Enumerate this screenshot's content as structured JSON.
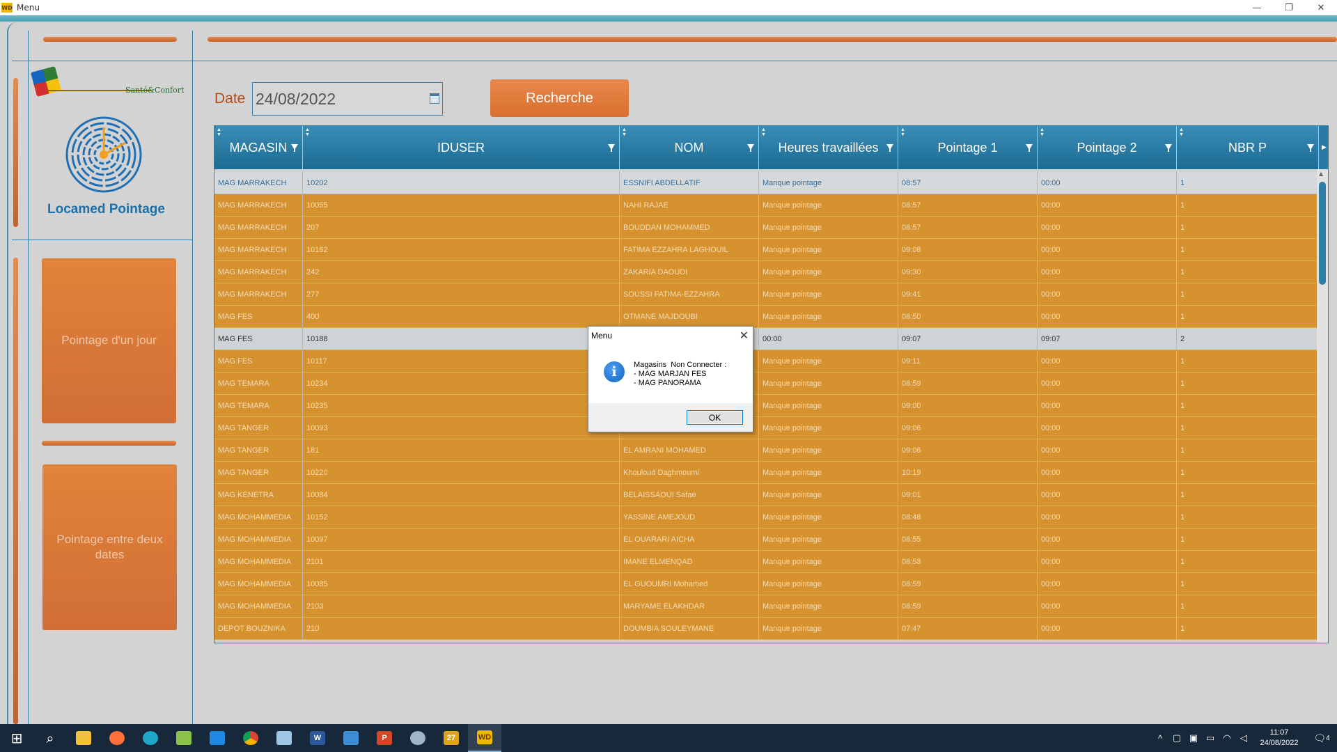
{
  "window": {
    "title": "Menu",
    "icon": "WD",
    "minimize": "—",
    "restore": "❐",
    "close": "✕"
  },
  "sidebar": {
    "logo_text": "Santé&Confort",
    "app_name": "Locamed Pointage",
    "btn_day": "Pointage d'un jour",
    "btn_range": "Pointage entre deux dates"
  },
  "search": {
    "date_label": "Date",
    "date_value": "24/08/2022",
    "button": "Recherche"
  },
  "table": {
    "columns": [
      "MAGASIN",
      "IDUSER",
      "NOM",
      "Heures travaillées",
      "Pointage 1",
      "Pointage 2",
      "NBR P"
    ],
    "rows": [
      [
        "MAG MARRAKECH",
        "10202",
        "ESSNIFI ABDELLATIF",
        "Manque pointage",
        "08:57",
        "00:00",
        "1"
      ],
      [
        "MAG MARRAKECH",
        "10055",
        "NAHI RAJAE",
        "Manque pointage",
        "08:57",
        "00:00",
        "1"
      ],
      [
        "MAG MARRAKECH",
        "207",
        "BOUDDAN MOHAMMED",
        "Manque pointage",
        "08:57",
        "00:00",
        "1"
      ],
      [
        "MAG MARRAKECH",
        "10162",
        "FATIMA EZZAHRA LAGHOUIL",
        "Manque pointage",
        "09:08",
        "00:00",
        "1"
      ],
      [
        "MAG MARRAKECH",
        "242",
        "ZAKARIA DAOUDI",
        "Manque pointage",
        "09:30",
        "00:00",
        "1"
      ],
      [
        "MAG MARRAKECH",
        "277",
        "SOUSSI FATIMA-EZZAHRA",
        "Manque pointage",
        "09:41",
        "00:00",
        "1"
      ],
      [
        "MAG FES",
        "400",
        "OTMANE MAJDOUBI",
        "Manque pointage",
        "08:50",
        "00:00",
        "1"
      ],
      [
        "MAG FES",
        "10188",
        "",
        "00:00",
        "09:07",
        "09:07",
        "2"
      ],
      [
        "MAG FES",
        "10117",
        "",
        "Manque pointage",
        "09:11",
        "00:00",
        "1"
      ],
      [
        "MAG TEMARA",
        "10234",
        "",
        "Manque pointage",
        "08:59",
        "00:00",
        "1"
      ],
      [
        "MAG TEMARA",
        "10235",
        "",
        "Manque pointage",
        "09:00",
        "00:00",
        "1"
      ],
      [
        "MAG TANGER",
        "10093",
        "",
        "Manque pointage",
        "09:06",
        "00:00",
        "1"
      ],
      [
        "MAG TANGER",
        "181",
        "EL AMRANI MOHAMED",
        "Manque pointage",
        "09:06",
        "00:00",
        "1"
      ],
      [
        "MAG TANGER",
        "10220",
        "Khouloud Daghmoumi",
        "Manque pointage",
        "10:19",
        "00:00",
        "1"
      ],
      [
        "MAG KENETRA",
        "10084",
        "BELAISSAOUI Safae",
        "Manque pointage",
        "09:01",
        "00:00",
        "1"
      ],
      [
        "MAG MOHAMMEDIA",
        "10152",
        "YASSINE AMEJOUD",
        "Manque pointage",
        "08:48",
        "00:00",
        "1"
      ],
      [
        "MAG MOHAMMEDIA",
        "10097",
        "EL OUARARI AICHA",
        "Manque pointage",
        "08:55",
        "00:00",
        "1"
      ],
      [
        "MAG MOHAMMEDIA",
        "2101",
        "IMANE ELMENQAD",
        "Manque pointage",
        "08:58",
        "00:00",
        "1"
      ],
      [
        "MAG MOHAMMEDIA",
        "10085",
        "EL GUOUMRI  Mohamed",
        "Manque pointage",
        "08:59",
        "00:00",
        "1"
      ],
      [
        "MAG MOHAMMEDIA",
        "2103",
        "MARYAME ELAKHDAR",
        "Manque pointage",
        "08:59",
        "00:00",
        "1"
      ],
      [
        "DEPOT BOUZNIKA",
        "210",
        "DOUMBIA SOULEYMANE",
        "Manque pointage",
        "07:47",
        "00:00",
        "1"
      ]
    ]
  },
  "dialog": {
    "title": "Menu",
    "close": "✕",
    "icon": "i",
    "message": "Magasins  Non Connecter :\n- MAG MARJAN FES\n- MAG PANORAMA",
    "ok": "OK"
  },
  "taskbar": {
    "start": "⊞",
    "search": "⌕",
    "apps": [
      "file-explorer",
      "firefox",
      "edge",
      "notepad-plus",
      "photos",
      "chrome",
      "notepad",
      "word",
      "remote-desktop",
      "powerpoint",
      "paint",
      "windev-27",
      "windev"
    ],
    "tray_up": "^",
    "time": "11:07",
    "date": "24/08/2022",
    "notifications": "4"
  },
  "colors": {
    "accent_orange": "#d6922f",
    "header_blue": "#1b6b93",
    "frame_blue": "#2f7ea8"
  }
}
